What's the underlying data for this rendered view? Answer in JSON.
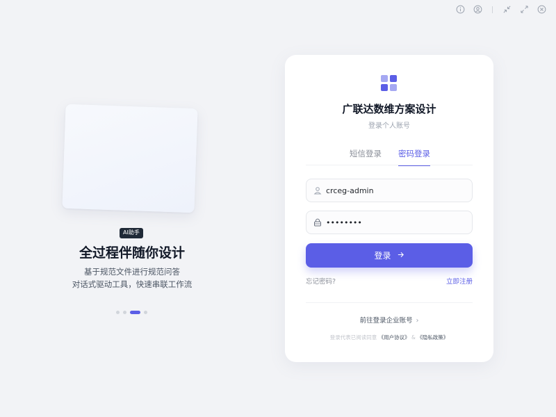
{
  "window_controls": [
    {
      "name": "info-icon"
    },
    {
      "name": "account-icon"
    },
    {
      "name": "minimize-icon"
    },
    {
      "name": "maximize-icon"
    },
    {
      "name": "close-icon"
    }
  ],
  "promo": {
    "badge": "AI助手",
    "title": "全过程伴随你设计",
    "subtitle_line1": "基于规范文件进行规范问答",
    "subtitle_line2": "对话式驱动工具，快速串联工作流",
    "dots_total": 4,
    "active_dot": 3
  },
  "login": {
    "brand": "广联达数维方案设计",
    "subtitle": "登录个人账号",
    "tabs": [
      {
        "label": "短信登录",
        "active": false
      },
      {
        "label": "密码登录",
        "active": true
      }
    ],
    "username": {
      "value": "crceg-admin",
      "icon": "user-icon"
    },
    "password": {
      "value": "password",
      "icon": "lock-icon"
    },
    "submit_label": "登录",
    "forgot_label": "忘记密码?",
    "register_label": "立即注册",
    "enterprise_label": "前往登录企业账号",
    "agreement_prefix": "登录代表已阅读同意",
    "user_agreement": "《用户协议》",
    "agreement_and": "&",
    "privacy_policy": "《隐私政策》"
  },
  "colors": {
    "accent": "#5b5ee6",
    "logo_light": "#a5a8f2",
    "background": "#f2f3f6"
  }
}
